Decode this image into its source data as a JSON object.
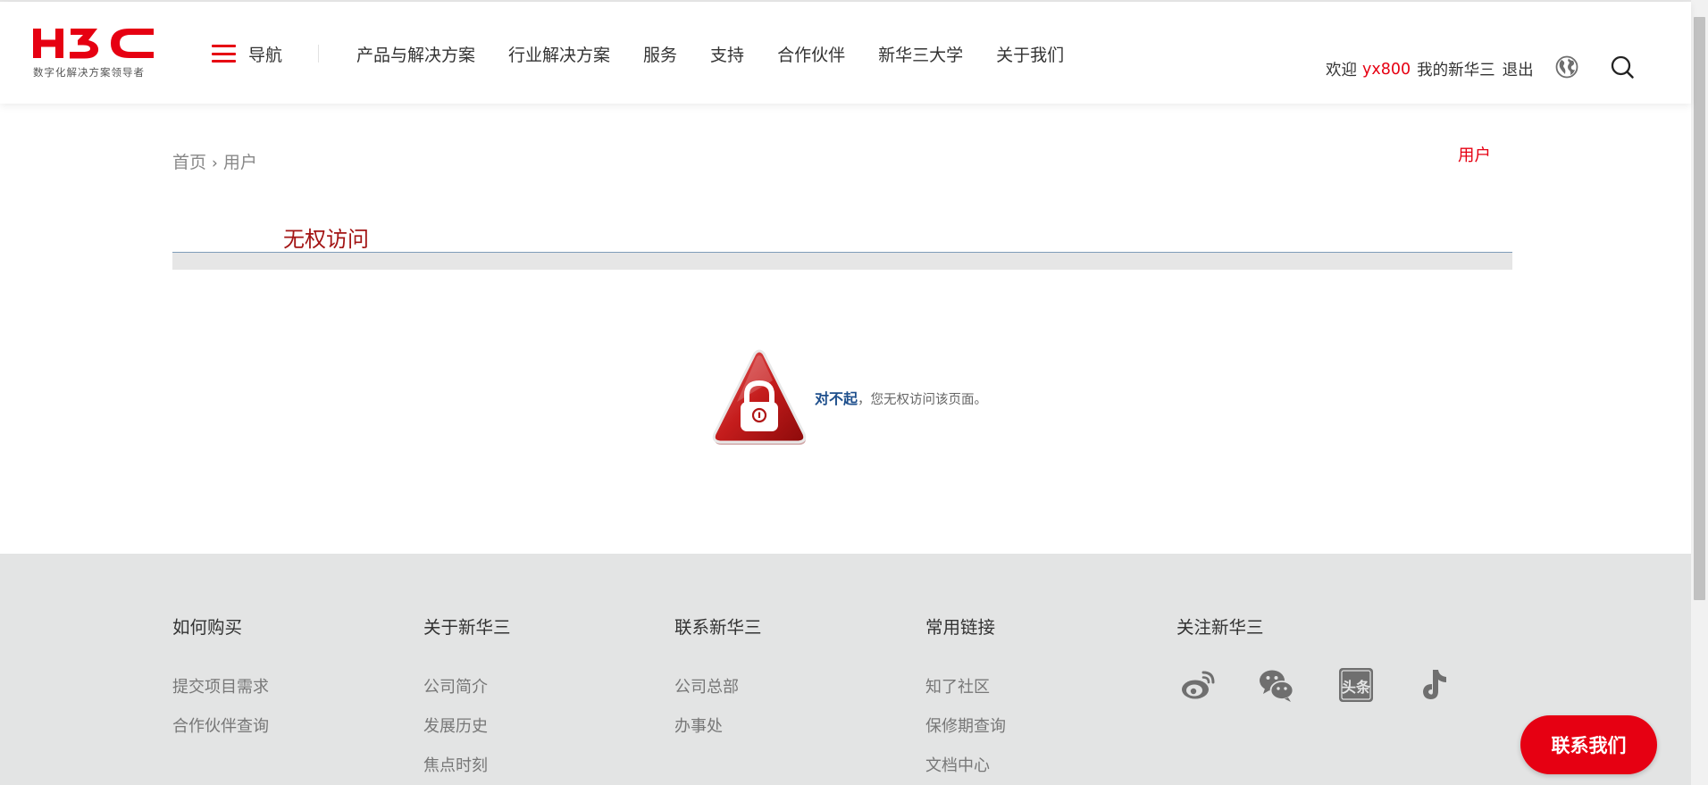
{
  "header": {
    "logo_text": "H3C",
    "logo_tagline": "数字化解决方案领导者",
    "nav_toggle_label": "导航",
    "menu": [
      "产品与解决方案",
      "行业解决方案",
      "服务",
      "支持",
      "合作伙伴",
      "新华三大学",
      "关于我们"
    ],
    "welcome": "欢迎",
    "username": "yx800",
    "my_link": "我的新华三",
    "logout": "退出",
    "brand_color": "#e60012"
  },
  "breadcrumb": {
    "home": "首页",
    "separator": "›",
    "current": "用户"
  },
  "side_link": "用户",
  "main": {
    "title": "无权访问",
    "error_strong": "对不起",
    "error_rest": "，您无权访问该页面。"
  },
  "footer": {
    "columns": [
      {
        "heading": "如何购买",
        "links": [
          "提交项目需求",
          "合作伙伴查询"
        ]
      },
      {
        "heading": "关于新华三",
        "links": [
          "公司简介",
          "发展历史",
          "焦点时刻"
        ]
      },
      {
        "heading": "联系新华三",
        "links": [
          "公司总部",
          "办事处"
        ]
      },
      {
        "heading": "常用链接",
        "links": [
          "知了社区",
          "保修期查询",
          "文档中心"
        ]
      },
      {
        "heading": "关注新华三",
        "links": []
      }
    ],
    "social_icons": [
      "weibo-icon",
      "wechat-icon",
      "toutiao-icon",
      "tiktok-icon"
    ],
    "toutiao_label": "头条",
    "contact_button": "联系我们"
  }
}
